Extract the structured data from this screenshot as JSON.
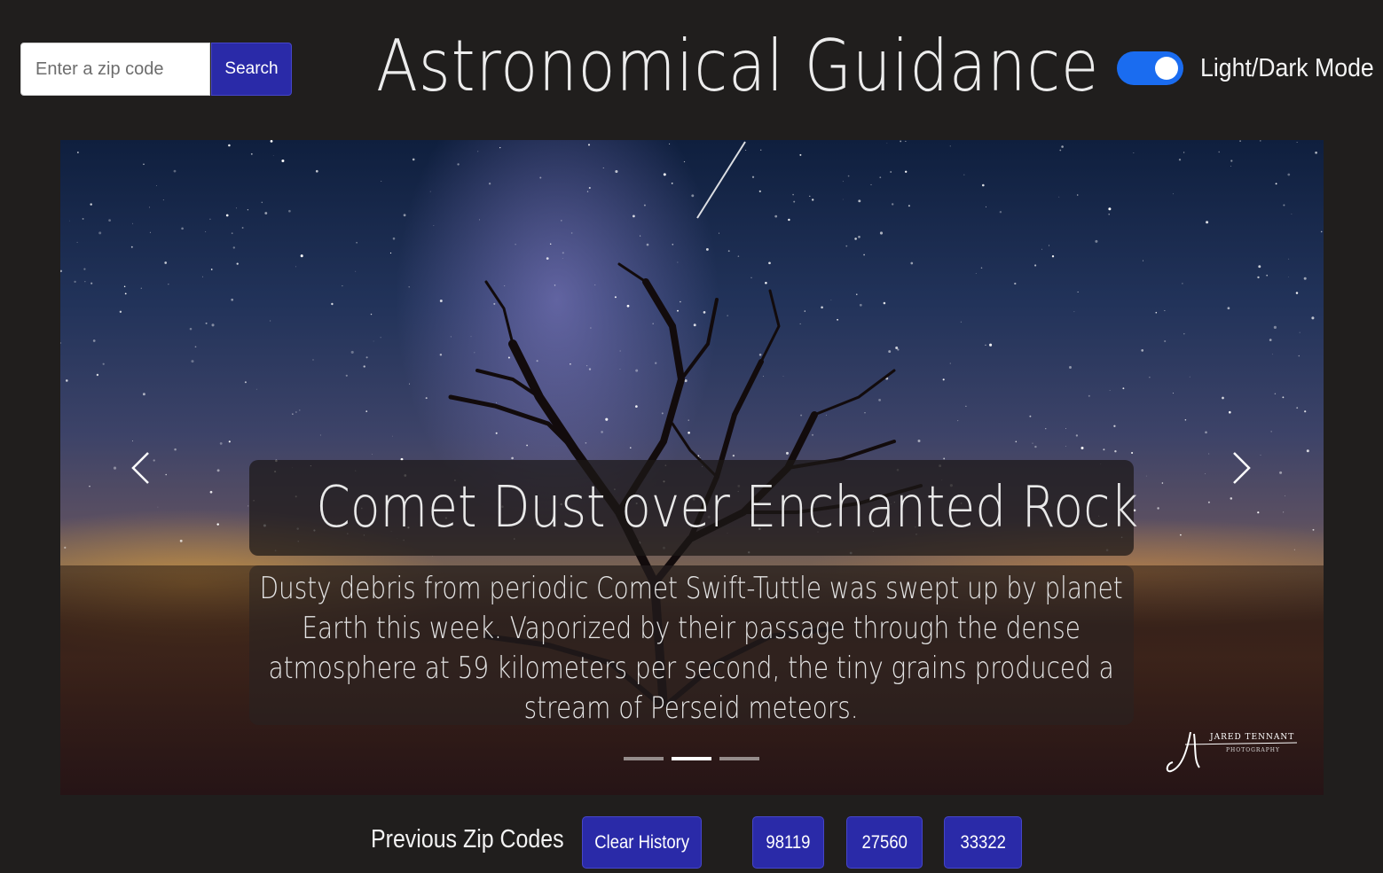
{
  "search": {
    "placeholder": "Enter a zip code",
    "button_label": "Search"
  },
  "header": {
    "title": "Astronomical Guidance",
    "toggle_label": "Light/Dark Mode",
    "toggle_on": true,
    "toggle_color": "#1a6cf0"
  },
  "carousel": {
    "slide_title": "Comet Dust over Enchanted Rock",
    "slide_description": "Dusty debris from periodic Comet Swift-Tuttle was swept up by planet Earth this week. Vaporized by their passage through the dense atmosphere at 59 kilometers per second, the tiny grains produced a stream of Perseid meteors.",
    "active_index": 1,
    "slide_count": 3,
    "prev_icon": "chevron-left-icon",
    "next_icon": "chevron-right-icon",
    "image_watermark": "JARED TENNANT PHOTOGRAPHY"
  },
  "history": {
    "label": "Previous Zip Codes",
    "clear_label": "Clear History",
    "zip_codes": [
      "98119",
      "27560",
      "33322"
    ],
    "button_color": "#2a2aa8"
  }
}
